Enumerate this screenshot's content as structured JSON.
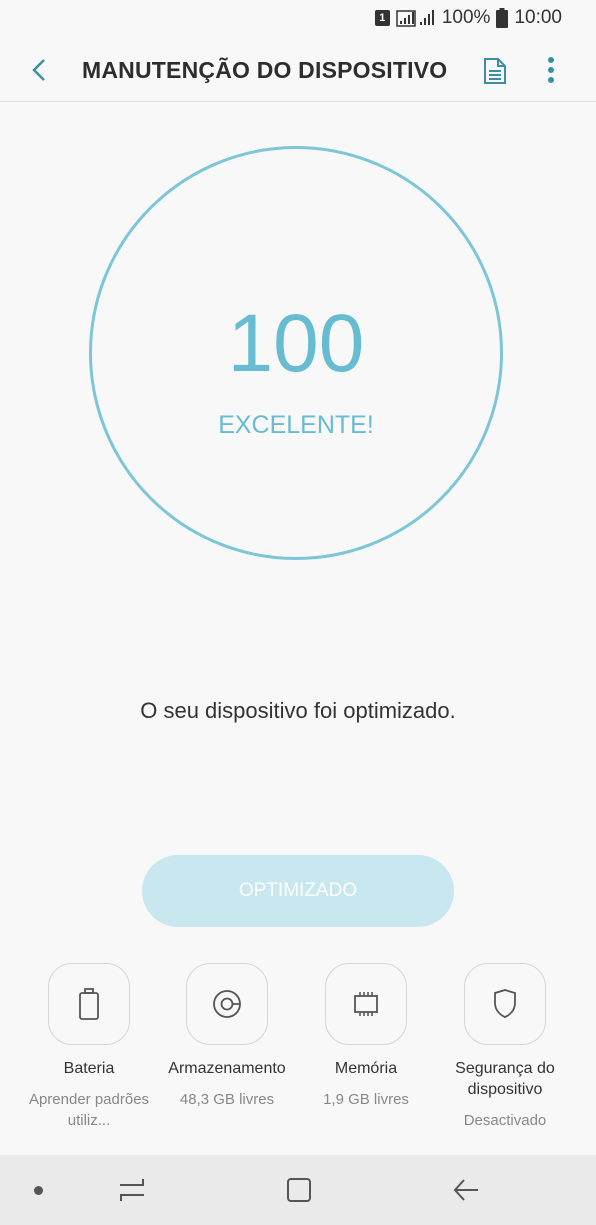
{
  "status_bar": {
    "sim": "1",
    "battery": "100%",
    "time": "10:00"
  },
  "app_bar": {
    "title": "MANUTENÇÃO DO DISPOSITIVO"
  },
  "score": {
    "value": "100",
    "label": "EXCELENTE!",
    "accent_color": "#68bcd2"
  },
  "status_message": "O seu dispositivo foi optimizado.",
  "optimize_button": {
    "label": "OPTIMIZADO",
    "color": "#c8e7ef"
  },
  "features": [
    {
      "icon": "battery-icon",
      "label": "Bateria",
      "sub": "Aprender padrões utiliz..."
    },
    {
      "icon": "storage-icon",
      "label": "Armazenamento",
      "sub": "48,3 GB livres"
    },
    {
      "icon": "memory-chip-icon",
      "label": "Memória",
      "sub": "1,9 GB livres"
    },
    {
      "icon": "shield-icon",
      "label": "Segurança do dispositivo",
      "sub": "Desactivado"
    }
  ]
}
